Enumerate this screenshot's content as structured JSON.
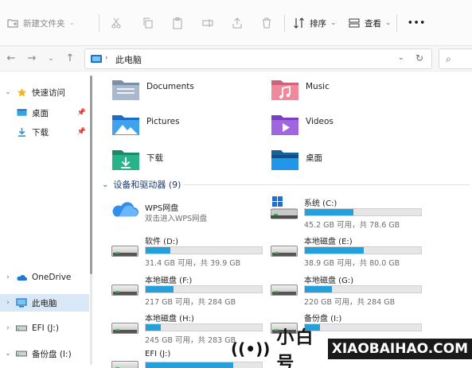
{
  "toolbar": {
    "new_folder": "新建文件夹",
    "sort": "排序",
    "view": "查看",
    "more": "•••"
  },
  "address": {
    "crumb": "此电脑",
    "search_icon": "search-icon"
  },
  "sidebar": {
    "items": [
      {
        "label": "快速访问",
        "icon": "star-icon"
      },
      {
        "label": "桌面",
        "icon": "desktop-folder-icon"
      },
      {
        "label": "下载",
        "icon": "download-folder-icon"
      },
      {
        "label": "OneDrive",
        "icon": "cloud-icon"
      },
      {
        "label": "此电脑",
        "icon": "pc-icon"
      },
      {
        "label": "EFI (J:)",
        "icon": "drive-icon"
      },
      {
        "label": "备份盘 (I:)",
        "icon": "drive-icon"
      }
    ]
  },
  "folders": [
    {
      "label": "Documents",
      "icon": "documents-folder-icon"
    },
    {
      "label": "Music",
      "icon": "music-folder-icon"
    },
    {
      "label": "Pictures",
      "icon": "pictures-folder-icon"
    },
    {
      "label": "Videos",
      "icon": "videos-folder-icon"
    },
    {
      "label": "下载",
      "icon": "download-folder-icon"
    },
    {
      "label": "桌面",
      "icon": "desktop-folder-icon"
    }
  ],
  "devices_group": {
    "title": "设备和驱动器 (9)"
  },
  "drives": [
    {
      "name": "WPS网盘",
      "info": "双击进入WPS网盘",
      "used_fraction": null
    },
    {
      "name": "系统 (C:)",
      "info": "45.2 GB 可用，共 78.6 GB",
      "used_fraction": 0.42
    },
    {
      "name": "软件 (D:)",
      "info": "31.4 GB 可用，共 39.9 GB",
      "used_fraction": 0.21
    },
    {
      "name": "本地磁盘 (E:)",
      "info": "38.9 GB 可用，共 80.0 GB",
      "used_fraction": 0.51
    },
    {
      "name": "本地磁盘 (F:)",
      "info": "217 GB 可用，共 284 GB",
      "used_fraction": 0.24
    },
    {
      "name": "本地磁盘 (G:)",
      "info": "220 GB 可用，共 284 GB",
      "used_fraction": 0.23
    },
    {
      "name": "本地磁盘 (H:)",
      "info": "245 GB 可用，共 283 GB",
      "used_fraction": 0.13
    },
    {
      "name": "备份盘 (I:)",
      "info": "",
      "used_fraction": 0.13
    },
    {
      "name": "EFI (J:)",
      "info": "",
      "used_fraction": 0.75
    }
  ],
  "watermark": {
    "cn": "小白号",
    "domain": "XIAOBAIHAO.COM"
  },
  "colors": {
    "accent": "#26a0da",
    "selected": "#d9e8f7"
  }
}
